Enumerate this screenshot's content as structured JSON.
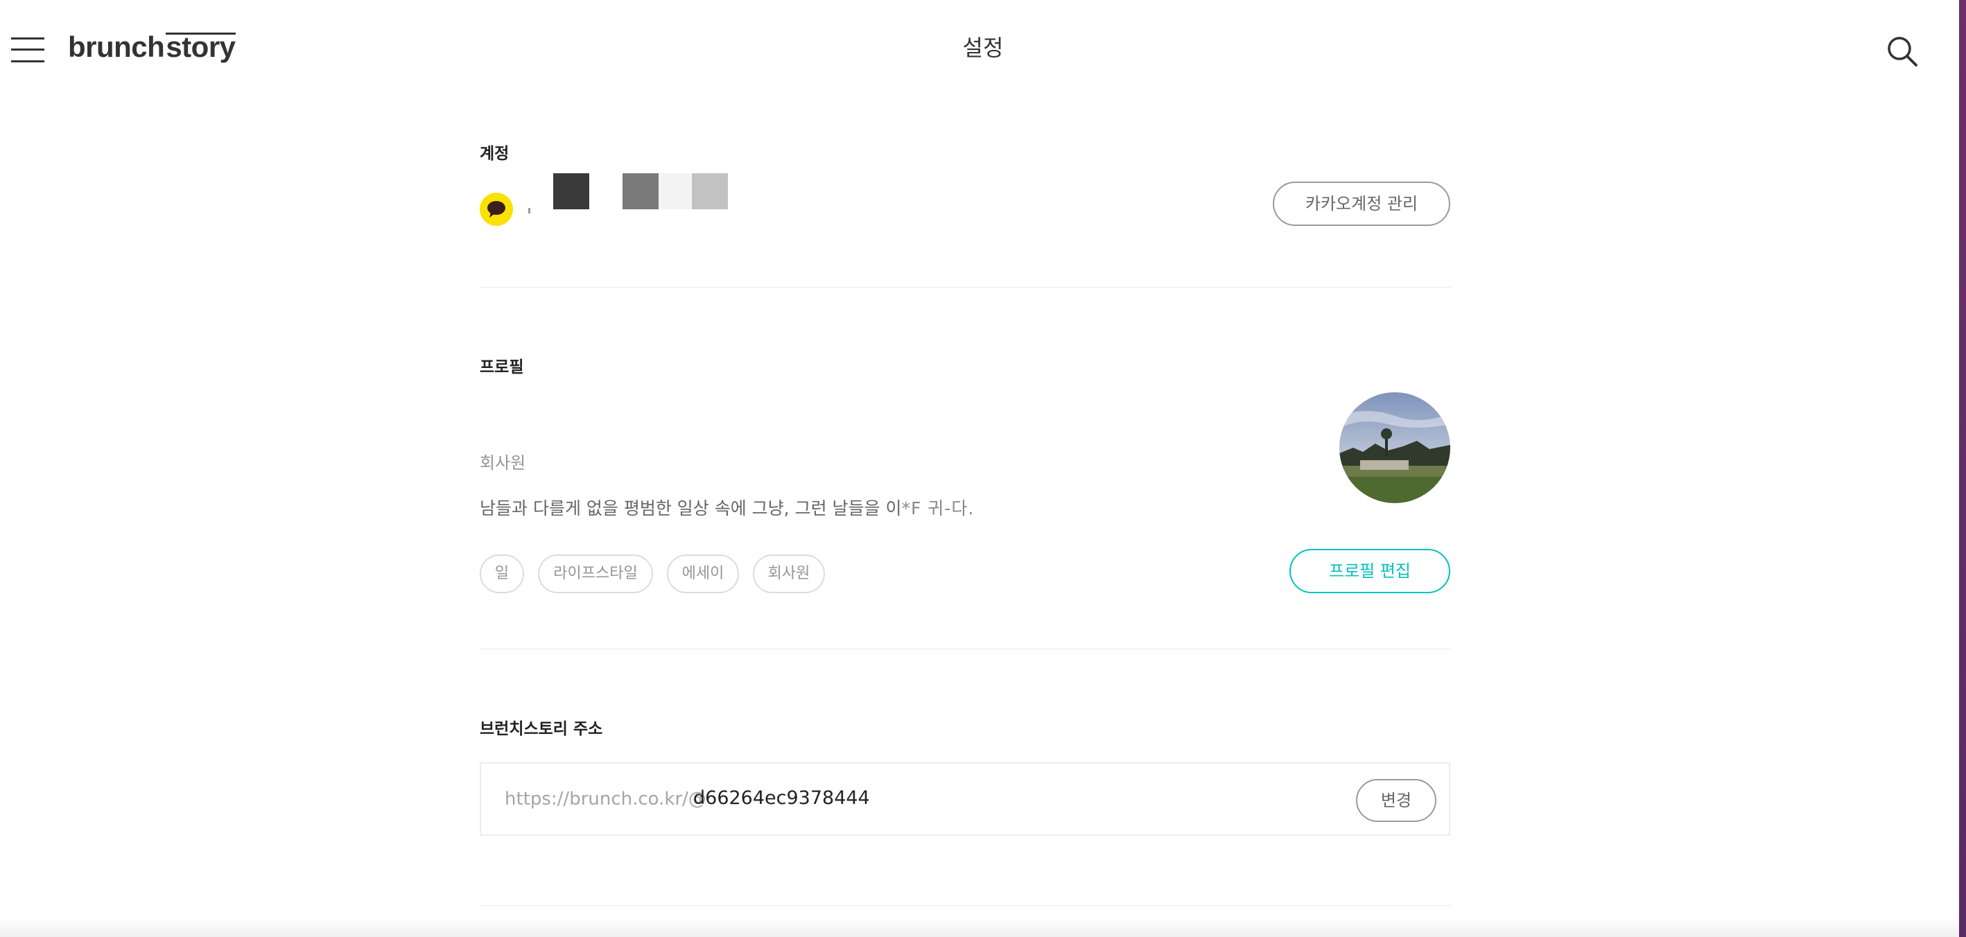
{
  "header": {
    "menu_icon": "hamburger-menu-icon",
    "logo_main": "brunch",
    "logo_sub": "story",
    "title": "설정",
    "search_icon": "search-icon"
  },
  "account": {
    "label": "계정",
    "kakao_icon": "kakao-talk-icon",
    "manage_button": "카카오계정 관리"
  },
  "profile": {
    "label": "프로필",
    "job": "회사원",
    "description": "남들과 다를게 없을 평범한 일상 속에 그냥, 그런 날들을 이",
    "description_garbled": "*F 귀-다.",
    "tags": [
      "일",
      "라이프스타일",
      "에세이",
      "회사원"
    ],
    "edit_button": "프로필 편집",
    "avatar": "profile-photo-landscape"
  },
  "address": {
    "label": "브런치스토리 주소",
    "prefix": "https://brunch.co.kr/@",
    "user_id": "d66264ec9378444",
    "change_button": "변경"
  },
  "colors": {
    "accent": "#00c3bd",
    "kakao_yellow": "#fae100",
    "edge": "#6b2f6a"
  }
}
